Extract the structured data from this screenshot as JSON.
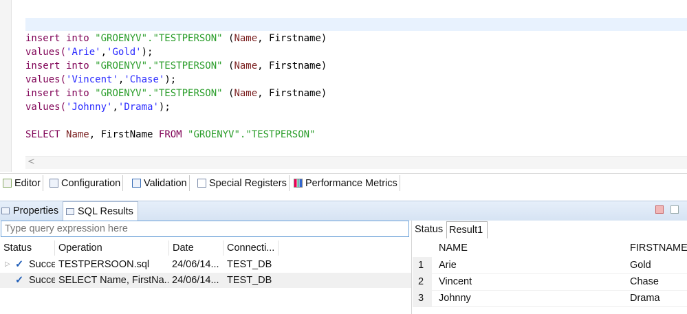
{
  "editor": {
    "lines": [
      [
        {
          "t": "insert into ",
          "c": "kw"
        },
        {
          "t": "\"GROENYV\".\"TESTPERSON\"",
          "c": "str"
        },
        {
          "t": " (",
          "c": "pln"
        },
        {
          "t": "Name",
          "c": "col"
        },
        {
          "t": ", Firstname)",
          "c": "pln"
        }
      ],
      [
        {
          "t": "values(",
          "c": "kw"
        },
        {
          "t": "'Arie'",
          "c": "val"
        },
        {
          "t": ",",
          "c": "pln"
        },
        {
          "t": "'Gold'",
          "c": "val"
        },
        {
          "t": ");",
          "c": "pln"
        }
      ],
      [
        {
          "t": "insert into ",
          "c": "kw"
        },
        {
          "t": "\"GROENYV\".\"TESTPERSON\"",
          "c": "str"
        },
        {
          "t": " (",
          "c": "pln"
        },
        {
          "t": "Name",
          "c": "col"
        },
        {
          "t": ", Firstname)",
          "c": "pln"
        }
      ],
      [
        {
          "t": "values(",
          "c": "kw"
        },
        {
          "t": "'Vincent'",
          "c": "val"
        },
        {
          "t": ",",
          "c": "pln"
        },
        {
          "t": "'Chase'",
          "c": "val"
        },
        {
          "t": ");",
          "c": "pln"
        }
      ],
      [
        {
          "t": "insert into ",
          "c": "kw"
        },
        {
          "t": "\"GROENYV\".\"TESTPERSON\"",
          "c": "str"
        },
        {
          "t": " (",
          "c": "pln"
        },
        {
          "t": "Name",
          "c": "col"
        },
        {
          "t": ", Firstname)",
          "c": "pln"
        }
      ],
      [
        {
          "t": "values(",
          "c": "kw"
        },
        {
          "t": "'Johnny'",
          "c": "val"
        },
        {
          "t": ",",
          "c": "pln"
        },
        {
          "t": "'Drama'",
          "c": "val"
        },
        {
          "t": ");",
          "c": "pln"
        }
      ],
      [],
      [
        {
          "t": "SELECT ",
          "c": "kw"
        },
        {
          "t": "Name",
          "c": "col"
        },
        {
          "t": ", FirstName ",
          "c": "pln"
        },
        {
          "t": "FROM ",
          "c": "kw"
        },
        {
          "t": "\"GROENYV\".\"TESTPERSON\"",
          "c": "str"
        }
      ]
    ]
  },
  "editor_tabs": {
    "editor": "Editor",
    "configuration": "Configuration",
    "validation": "Validation",
    "special_registers": "Special Registers",
    "performance_metrics": "Performance Metrics"
  },
  "view_tabs": {
    "properties": "Properties",
    "sql_results": "SQL Results"
  },
  "history": {
    "query_placeholder": "Type query expression here",
    "columns": [
      "Status",
      "Operation",
      "Date",
      "Connecti..."
    ],
    "rows": [
      {
        "status": "Succe",
        "operation": "TESTPERSOON.sql",
        "date": "24/06/14...",
        "connection": "TEST_DB"
      },
      {
        "status": "Succe",
        "operation": "SELECT Name, FirstNa...",
        "date": "24/06/14...",
        "connection": "TEST_DB"
      }
    ]
  },
  "result": {
    "tabs": {
      "status": "Status",
      "result1": "Result1"
    },
    "columns": [
      "NAME",
      "FIRSTNAME"
    ],
    "rows": [
      {
        "num": "1",
        "name": "Arie",
        "firstname": "Gold"
      },
      {
        "num": "2",
        "name": "Vincent",
        "firstname": "Chase"
      },
      {
        "num": "3",
        "name": "Johnny",
        "firstname": "Drama"
      }
    ]
  }
}
